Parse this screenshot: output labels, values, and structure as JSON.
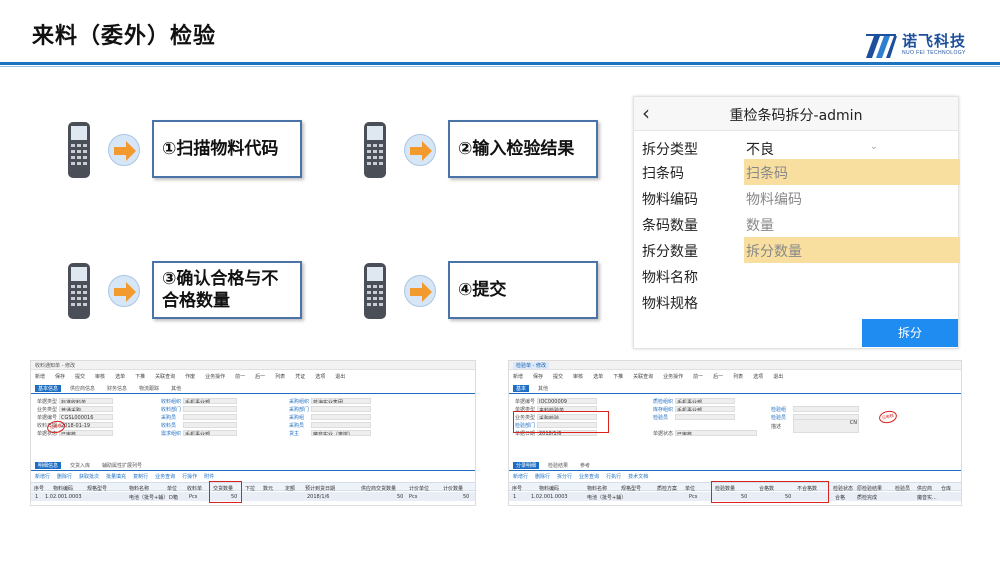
{
  "slide": {
    "title": "来料（委外）检验"
  },
  "logo": {
    "cn": "诺飞科技",
    "en": "NUO FEI TECHNOLOGY"
  },
  "steps": [
    {
      "label": "①扫描物料代码"
    },
    {
      "label": "②输入检验结果"
    },
    {
      "label": "③确认合格与不合格数量"
    },
    {
      "label": "④提交"
    }
  ],
  "mobile": {
    "title": "重检条码拆分-admin",
    "back_icon": "chevron-left-icon",
    "rows": [
      {
        "label": "拆分类型",
        "value": "不良"
      },
      {
        "label": "扫条码",
        "value": "扫条码"
      },
      {
        "label": "物料编码",
        "value": "物料编码"
      },
      {
        "label": "条码数量",
        "value": "数量"
      },
      {
        "label": "拆分数量",
        "value": "拆分数量"
      },
      {
        "label": "物料名称",
        "value": ""
      },
      {
        "label": "物料规格",
        "value": ""
      }
    ],
    "button": "拆分",
    "highlight_color": "#f8dfa0",
    "button_color": "#1e8cf0"
  },
  "erp_left": {
    "topbar": "收料通知单 - 修改",
    "toolbar": [
      "新增",
      "保存",
      "提交",
      "审核",
      "选单",
      "下推",
      "关联查询",
      "作废",
      "业务操作",
      "前一",
      "后一",
      "列表",
      "凭证",
      "选项",
      "退出"
    ],
    "tabs": [
      "基本信息",
      "供应商信息",
      "财务信息",
      "物流跟踪",
      "其他"
    ],
    "fields": [
      {
        "label": "单据类型",
        "value": "标准收料单"
      },
      {
        "label": "业务类型",
        "value": "普通采购"
      },
      {
        "label": "单据编号",
        "value": "CGSL000016"
      },
      {
        "label": "收料日期",
        "value": "2018-01-19"
      },
      {
        "label": "单据状态",
        "value": "已审核"
      },
      {
        "label": "收料组织",
        "value": "手机事业部"
      },
      {
        "label": "收料部门",
        "value": ""
      },
      {
        "label": "采购员",
        "value": ""
      },
      {
        "label": "收料员",
        "value": ""
      },
      {
        "label": "需求组织",
        "value": "手机事业部"
      },
      {
        "label": "采购组织",
        "value": "蓝海实业集团"
      },
      {
        "label": "采购部门",
        "value": ""
      },
      {
        "label": "采购组",
        "value": ""
      },
      {
        "label": "采购员",
        "value": ""
      },
      {
        "label": "货主",
        "value": "魔音实业（离岸）"
      }
    ],
    "detail_tabs": [
      "明细信息",
      "交货入库",
      "辅助属性扩展列号"
    ],
    "subbar": [
      "新增行",
      "删除行",
      "获取批次",
      "批量填充",
      "复制行",
      "业务查询",
      "行操作",
      "附件"
    ],
    "columns": [
      "序号",
      "物料编码",
      "规格型号",
      "物料名称",
      "单位",
      "收料单",
      "交货数量",
      "下拉",
      "数元",
      "定额",
      "预计到货日期",
      "供应商交货数量",
      "计价单位",
      "计价数量"
    ],
    "row": {
      "no": "1",
      "code": "1.02.001.0003",
      "name": "电池（批号+辅）",
      "unit": "D箱",
      "pcs": "Pcs",
      "qty": "50",
      "date": "2018/1/6",
      "supplier_qty": "50",
      "unit2": "Pcs",
      "price_qty": "50"
    },
    "stamp": "已审核"
  },
  "erp_right": {
    "topbar": "检验单 - 修改",
    "toolbar": [
      "新增",
      "保存",
      "提交",
      "审核",
      "选单",
      "下推",
      "关联查询",
      "业务操作",
      "前一",
      "后一",
      "列表",
      "选项",
      "退出"
    ],
    "tabs": [
      "基本",
      "其他"
    ],
    "fields": [
      {
        "label": "单据编号",
        "value": "IQC000009"
      },
      {
        "label": "单据类型",
        "value": "来料检验单"
      },
      {
        "label": "业务类型",
        "value": "采购检验"
      },
      {
        "label": "检验部门",
        "value": ""
      },
      {
        "label": "单据日期",
        "value": "2018/1/6"
      },
      {
        "label": "质检组织",
        "value": "手机事业部"
      },
      {
        "label": "库存组织",
        "value": "手机事业部"
      },
      {
        "label": "检验员",
        "value": ""
      },
      {
        "label": "单据状态",
        "value": "已审核"
      },
      {
        "label": "检验组",
        "value": ""
      },
      {
        "label": "检验员",
        "value": ""
      },
      {
        "label": "描述",
        "value": "CN"
      }
    ],
    "detail_tabs": [
      "分录明细",
      "检验结果",
      "参考"
    ],
    "subbar": [
      "新增行",
      "删除行",
      "拆分行",
      "业务查询",
      "行执行",
      "技术文档"
    ],
    "columns": [
      "序号",
      "物料编码",
      "物料名称",
      "规格型号",
      "质检方案",
      "单位",
      "检验数量",
      "合格数",
      "不合格数",
      "检验状态",
      "原检验结果",
      "检验员",
      "供应商",
      "仓库"
    ],
    "row": {
      "no": "1",
      "code": "1.02.001.0003",
      "name": "电池（批号+辅）",
      "unit": "Pcs",
      "check_qty": "50",
      "ok_qty": "50",
      "ng_qty": "",
      "status": "合格",
      "result": "质检完成",
      "supplier": "魔音实..."
    },
    "stamp": "已审核"
  }
}
